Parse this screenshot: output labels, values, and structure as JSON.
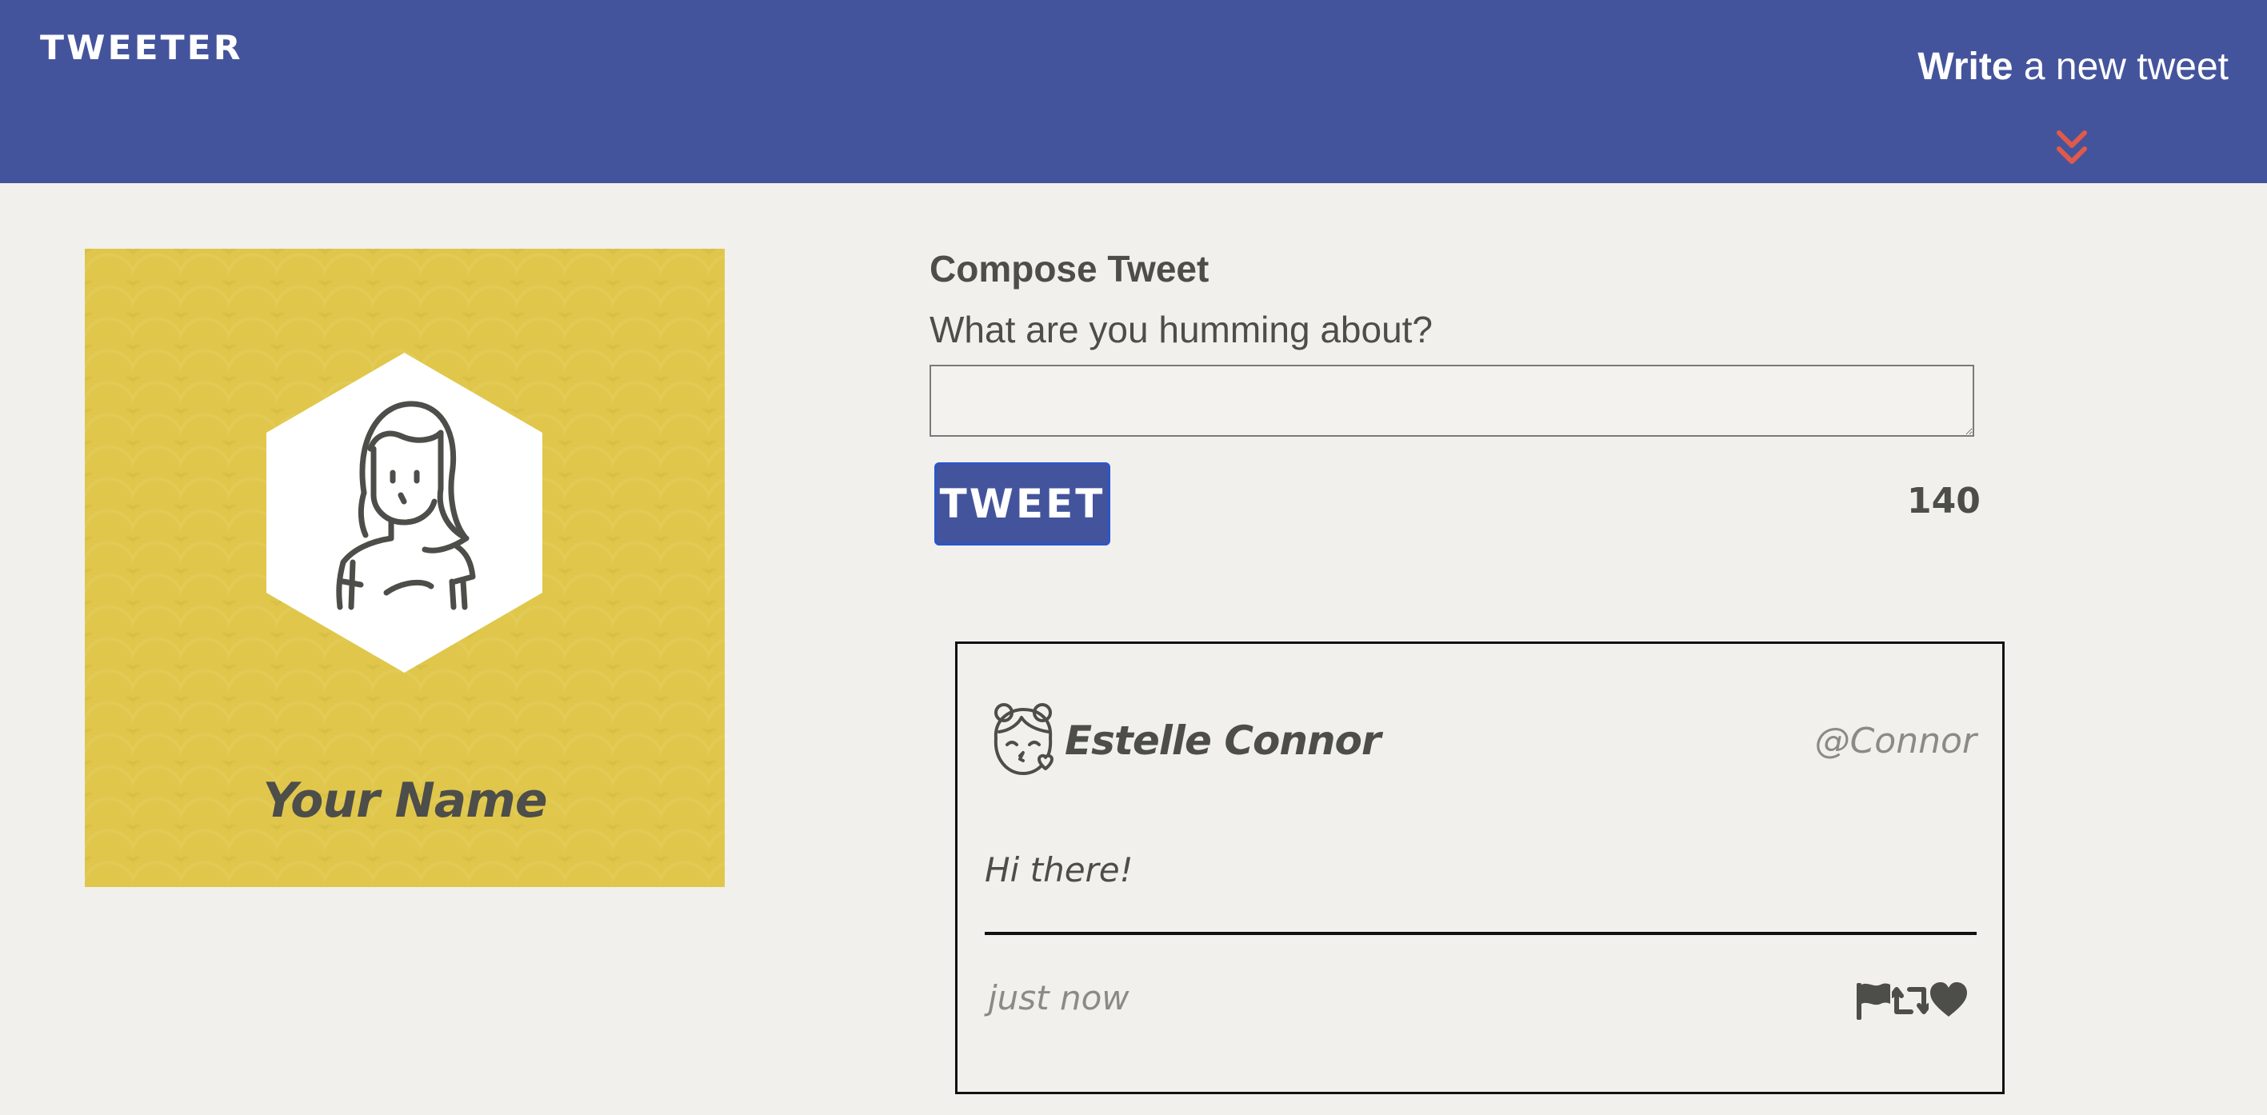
{
  "nav": {
    "logo": "TWEETER",
    "write_strong": "Write",
    "write_rest": " a new tweet",
    "chevron_icon": "double-chevron-down-icon",
    "background_color": "#44549c",
    "chevron_color": "#e05a4a"
  },
  "profile": {
    "name": "Your Name",
    "avatar_icon": "girl-avatar-icon",
    "background_color": "#e0c74b"
  },
  "compose": {
    "title": "Compose Tweet",
    "prompt": "What are you humming about?",
    "textarea_value": "",
    "button_label": "TWEET",
    "char_count": "140"
  },
  "tweets": [
    {
      "avatar_icon": "girl-kiss-avatar-icon",
      "author": "Estelle Connor",
      "handle": "@Connor",
      "text": "Hi there!",
      "time": "just now",
      "actions": [
        "flag-icon",
        "retweet-icon",
        "heart-icon"
      ]
    }
  ],
  "colors": {
    "page_background": "#f1f0ec",
    "text": "#4d4d4a",
    "button": "#44549c"
  }
}
